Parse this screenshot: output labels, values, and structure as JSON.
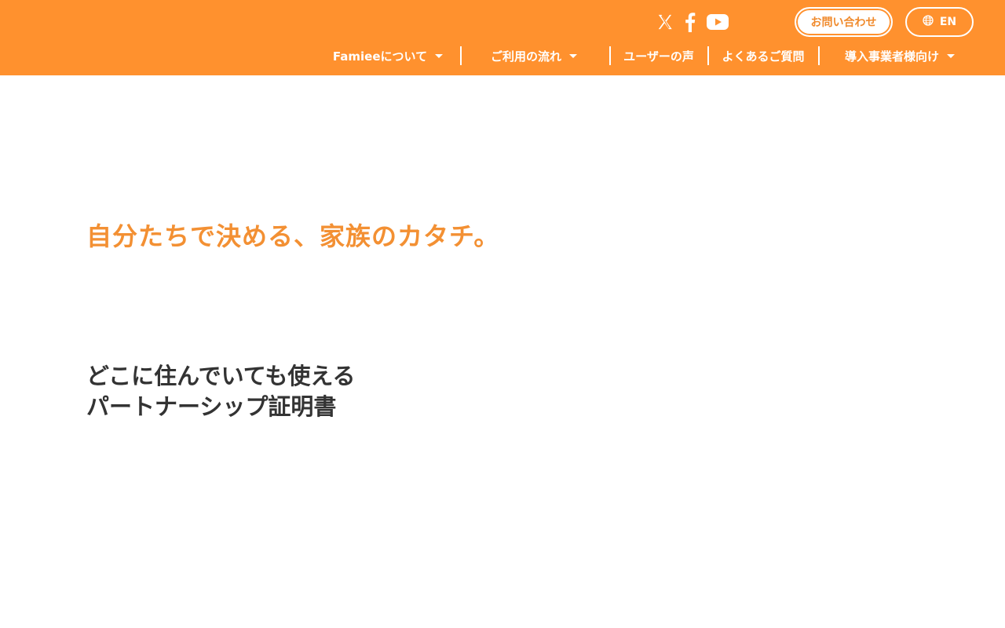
{
  "header": {
    "social": [
      {
        "name": "x-icon"
      },
      {
        "name": "facebook-icon"
      },
      {
        "name": "youtube-icon"
      }
    ],
    "contact_label": "お問い合わせ",
    "language_label": "EN",
    "nav": {
      "about": "Famieeについて",
      "flow": "ご利用の流れ",
      "voices": "ユーザーの声",
      "faq": "よくあるご質問",
      "business": "導入事業者様向け"
    }
  },
  "hero": {
    "tagline": "自分たちで決める、家族のカタチ。",
    "subtitle_line1": "どこに住んでいても使える",
    "subtitle_line2": "パートナーシップ証明書"
  },
  "colors": {
    "brand_orange": "#FF912E",
    "tagline_orange": "#F39033",
    "text_dark": "#333333"
  }
}
